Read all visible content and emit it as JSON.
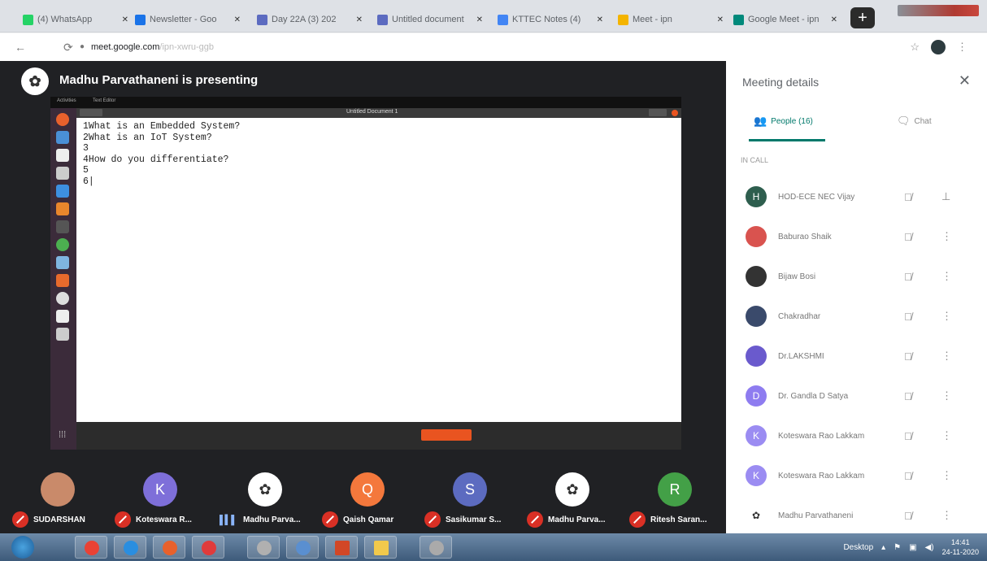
{
  "browser": {
    "tabs": [
      {
        "label": "(4) WhatsApp",
        "color": "#25d366"
      },
      {
        "label": "Newsletter - Goo",
        "color": "#1a73e8"
      },
      {
        "label": "Day 22A (3) 202",
        "color": "#5c6bc0"
      },
      {
        "label": "Untitled document",
        "color": "#5c6bc0"
      },
      {
        "label": "KTTEC Notes (4)",
        "color": "#4285f4"
      },
      {
        "label": "Meet - ipn",
        "color": "#f4b400"
      },
      {
        "label": "Google Meet - ipn",
        "color": "#00897b"
      }
    ],
    "new_tab": "+",
    "url_host": "meet.google.com",
    "url_path": "/ipn-xwru-ggb"
  },
  "meet": {
    "presenting_title": "Madhu Parvathaneni is presenting",
    "shared_screen": {
      "file_name": "Untitled Document 1",
      "menu_items": [
        "Activities",
        "Text Editor"
      ],
      "lines": [
        "1What is an Embedded System?",
        "2What is an IoT System?",
        "3",
        "4How do you differentiate?",
        "5",
        "6|"
      ]
    },
    "participants_strip": [
      {
        "name": "SUDARSHAN",
        "initial": "",
        "color": "#c98a6a",
        "muted": true
      },
      {
        "name": "Koteswara R...",
        "initial": "K",
        "color": "#7e6fd9",
        "muted": true
      },
      {
        "name": "Madhu Parva...",
        "initial": "",
        "color": "#ffffff",
        "muted": false,
        "speaking": true
      },
      {
        "name": "Qaish Qamar",
        "initial": "Q",
        "color": "#f4783c",
        "muted": true
      },
      {
        "name": "Sasikumar S...",
        "initial": "S",
        "color": "#5c6bc0",
        "muted": true
      },
      {
        "name": "Madhu Parva...",
        "initial": "",
        "color": "#ffffff",
        "muted": true
      },
      {
        "name": "Ritesh Saran...",
        "initial": "R",
        "color": "#43a047",
        "muted": true
      }
    ]
  },
  "panel": {
    "title": "Meeting details",
    "tab_people": "People (16)",
    "tab_chat": "Chat",
    "section_label": "IN CALL",
    "people": [
      {
        "name": "HOD-ECE NEC Vijay",
        "initial": "H",
        "color": "#2e5e4e",
        "action": "pin"
      },
      {
        "name": "Baburao Shaik",
        "initial": "",
        "color": "#d9534f",
        "action": "more"
      },
      {
        "name": "Bijaw Bosi",
        "initial": "",
        "color": "#333333",
        "action": "more"
      },
      {
        "name": "Chakradhar",
        "initial": "",
        "color": "#3a4a6b",
        "action": "more"
      },
      {
        "name": "Dr.LAKSHMI",
        "initial": "",
        "color": "#6a5acd",
        "action": "more"
      },
      {
        "name": "Dr. Gandla D Satya",
        "initial": "D",
        "color": "#8e7cf0",
        "action": "more"
      },
      {
        "name": "Koteswara Rao Lakkam",
        "initial": "K",
        "color": "#9b8cf2",
        "action": "more"
      },
      {
        "name": "Koteswara Rao Lakkam",
        "initial": "K",
        "color": "#9b8cf2",
        "action": "more"
      },
      {
        "name": "Madhu Parvathaneni",
        "initial": "",
        "color": "#ffffff",
        "action": "more"
      }
    ]
  },
  "taskbar": {
    "tray_label": "Desktop",
    "time": "14:41",
    "date": "24-11-2020"
  }
}
